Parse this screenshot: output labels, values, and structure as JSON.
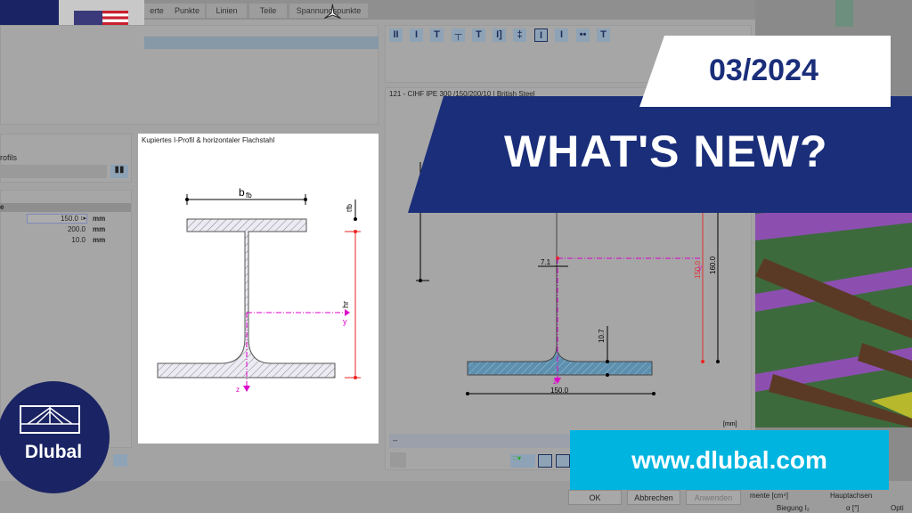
{
  "tabs": [
    "erte",
    "Punkte",
    "Linien",
    "Teile",
    "Spannungspunkte"
  ],
  "left": {
    "section_label": "rofils",
    "table_header": "e",
    "rows": [
      {
        "value": "150.0",
        "unit": "mm"
      },
      {
        "value": "200.0",
        "unit": "mm"
      },
      {
        "value": "10.0",
        "unit": "mm"
      }
    ]
  },
  "diagram_left": {
    "title": "Kupiertes I-Profil & horizontaler Flachstahl",
    "bfb": "b",
    "bfb_sub": "fb",
    "tfb": "tfb",
    "hr": "hr",
    "y": "y",
    "z": "z"
  },
  "toolbar_icons": [
    "II",
    "I",
    "T",
    "┬",
    "T",
    "I]",
    "‡",
    "I",
    "I",
    "••",
    "T"
  ],
  "diagram_right": {
    "title": "121 - CIHF IPE 300 /150/200/10 | British Steel",
    "web_t": "7.1",
    "flange_t": "10.7",
    "width": "150.0",
    "h1": "150.0",
    "h2": "160.0",
    "z": "z",
    "y": "y",
    "unit": "[mm]",
    "status": "--"
  },
  "dialog": {
    "ok": "OK",
    "cancel": "Abbrechen",
    "apply": "Anwenden",
    "col1": "mente [cm⁴]",
    "col2": "Hauptachsen",
    "col1_sub": "Biegung I₂",
    "col2_sub": "α [°]",
    "col3": "Opti"
  },
  "promo": {
    "date": "03/2024",
    "headline": "WHAT'S NEW?",
    "url": "www.dlubal.com",
    "logo": "Dlubal",
    "accent": "#1a2e7a",
    "cyan": "#00b4e0"
  }
}
